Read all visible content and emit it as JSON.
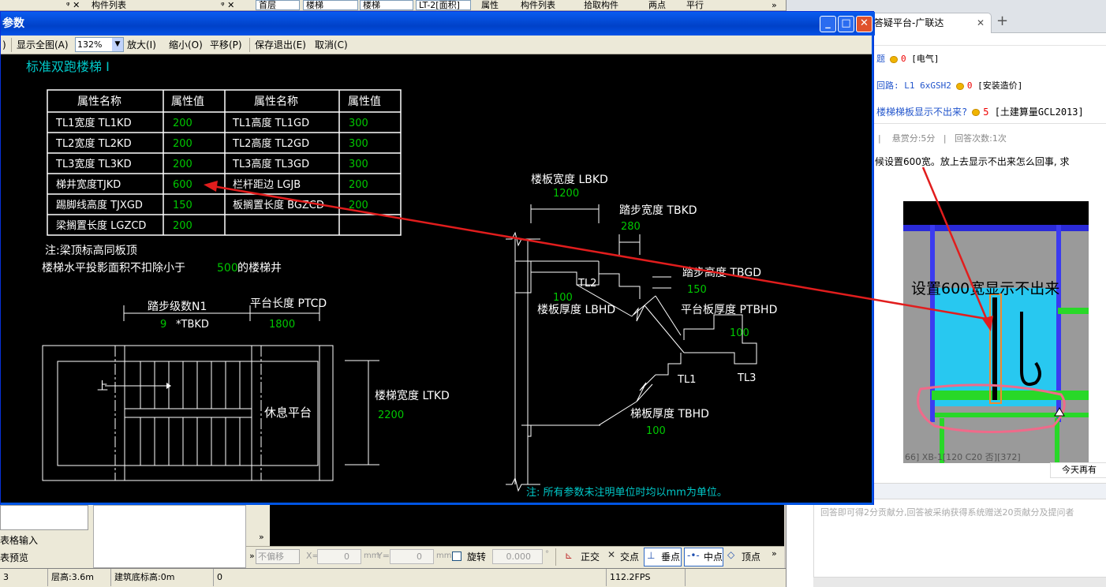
{
  "app": {
    "top_panels": {
      "left_panel": "属性",
      "middle_panel": "构件列表"
    },
    "selectors": [
      "首层",
      "楼梯",
      "楼梯",
      "LT-2[面积]"
    ],
    "toolbar_items": [
      "属性",
      "构件列表",
      "拾取构件",
      "两点",
      "平行"
    ]
  },
  "dialog": {
    "title": "参数",
    "toolbar": {
      "show_all": "显示全图(A)",
      "zoom_value": "132%",
      "zoom_in": "放大(I)",
      "zoom_out": "缩小(O)",
      "pan": "平移(P)",
      "save_exit": "保存退出(E)",
      "cancel": "取消(C)"
    },
    "drawing": {
      "heading": "标准双跑楼梯 I",
      "table": {
        "headers": [
          "属性名称",
          "属性值",
          "属性名称",
          "属性值"
        ],
        "rows": [
          [
            "TL1宽度 TL1KD",
            "200",
            "TL1高度 TL1GD",
            "300"
          ],
          [
            "TL2宽度 TL2KD",
            "200",
            "TL2高度 TL2GD",
            "300"
          ],
          [
            "TL3宽度 TL3KD",
            "200",
            "TL3高度 TL3GD",
            "300"
          ],
          [
            "梯井宽度TJKD",
            "600",
            "栏杆距边 LGJB",
            "200"
          ],
          [
            "踢脚线高度 TJXGD",
            "150",
            "板搁置长度 BGZCD",
            "200"
          ],
          [
            "梁搁置长度 LGZCD",
            "200",
            "",
            ""
          ]
        ]
      },
      "note1": "注:梁顶标高同板顶",
      "note2_prefix": "楼梯水平投影面积不扣除小于",
      "note2_value": "500",
      "note2_suffix": "的楼梯井",
      "step_count_label": "踏步级数N1",
      "step_count_value": "9",
      "step_count_expr": "*TBKD",
      "platform_length_label": "平台长度 PTCD",
      "platform_length_value": "1800",
      "up_label": "上",
      "rest_platform": "休息平台",
      "stair_width_label": "楼梯宽度 LTKD",
      "stair_width_value": "2200",
      "slab_width_label": "楼板宽度 LBKD",
      "slab_width_value": "1200",
      "tread_width_label": "踏步宽度 TBKD",
      "tread_width_value": "280",
      "tread_height_label": "踏步高度 TBGD",
      "tread_height_value": "150",
      "tl2": "TL2",
      "slab_thick_value": "100",
      "slab_thick_label": "楼板厚度 LBHD",
      "platform_thick_label": "平台板厚度 PTBHD",
      "platform_thick_value": "100",
      "tl1": "TL1",
      "tl3": "TL3",
      "stair_slab_label": "梯板厚度 TBHD",
      "stair_slab_value": "100",
      "unit_note": "注: 所有参数未注明单位时均以mm为单位。"
    }
  },
  "bottom": {
    "left_items": [
      "表格输入",
      "表预览"
    ],
    "snap": {
      "offset_select": "不偏移",
      "x_label": "X=",
      "x_value": "0",
      "y_label": "Y=",
      "y_value": "0",
      "unit": "mm",
      "rotate_label": "旋转",
      "rotate_value": "0.000",
      "ortho": "正交",
      "intersection": "交点",
      "perpendicular": "垂点",
      "midpoint": "中点",
      "vertex": "顶点"
    },
    "status": {
      "left": "3",
      "floor_height": "层高:3.6m",
      "base_elev": "建筑底标高:0m",
      "count": "0",
      "fps": "112.2FPS"
    }
  },
  "browser": {
    "tab_title": "问题答疑平台-广联达",
    "lines": [
      {
        "text": "题",
        "coin": "0",
        "tag": "[电气]"
      },
      {
        "text": "回路: L1 6xGSH2",
        "coin": "0",
        "tag": "[安装造价]"
      },
      {
        "text": "楼梯梯板显示不出来?",
        "coin": "5",
        "tag": "[土建算量GCL2013]"
      }
    ],
    "meta": {
      "reward": "悬赏分:5分",
      "answers": "回答次数:1次"
    },
    "body_text": "候设置600宽。放上去显示不出来怎么回事, 求",
    "image_caption": "设置600宽显示不出来",
    "image_footer": "66]   XB-1[120 C20 否][372]",
    "today": "今天再有",
    "answer_hint": "回答即可得2分贡献分,回答被采纳获得系统赠送20贡献分及提问者"
  },
  "colors": {
    "canvas_bg": "#000000",
    "value_green": "#00c800",
    "heading_cyan": "#00c8c8",
    "arrow_red": "#e11d1d",
    "title_blue": "#0054e3"
  }
}
